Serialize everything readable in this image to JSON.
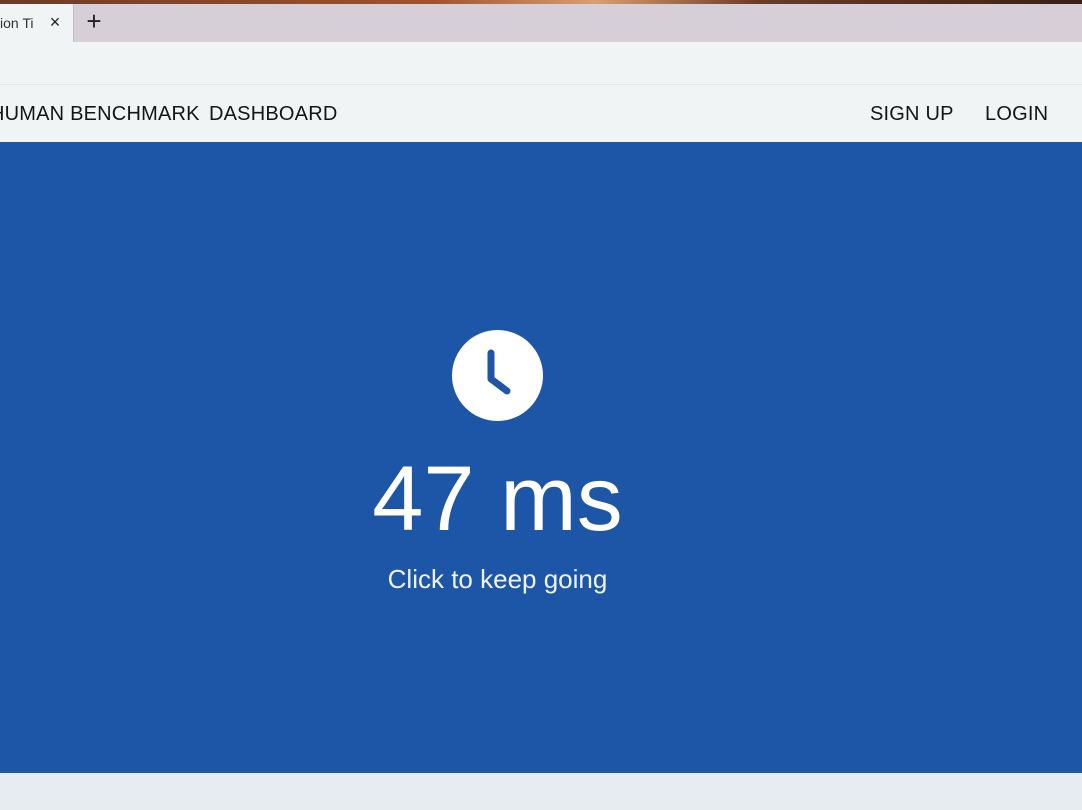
{
  "browser": {
    "tab_title": "ion Ti",
    "tab_close": "×",
    "new_tab": "+"
  },
  "navbar": {
    "brand": "HUMAN BENCHMARK",
    "dashboard": "DASHBOARD",
    "signup": "SIGN UP",
    "login": "LOGIN"
  },
  "test": {
    "icon": "clock-icon",
    "result": "47 ms",
    "prompt": "Click to keep going"
  },
  "colors": {
    "main_background": "#1d56a7",
    "text": "#ffffff",
    "nav_background": "#f0f4f5"
  }
}
